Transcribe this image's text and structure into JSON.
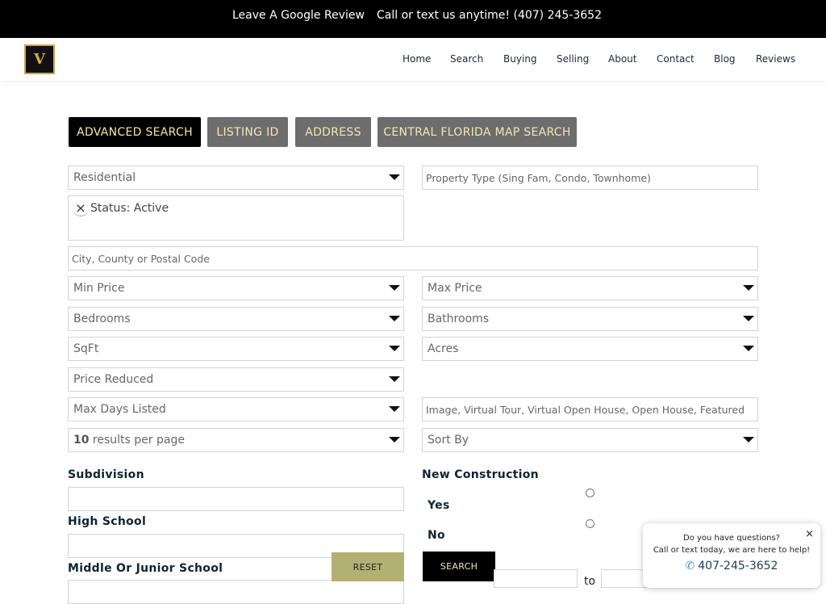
{
  "topbar": {
    "review": "Leave A Google Review",
    "call": "Call or text us anytime! (407) 245-3652"
  },
  "logo": {
    "letter": "V"
  },
  "nav": [
    "Home",
    "Search",
    "Buying",
    "Selling",
    "About",
    "Contact",
    "Blog",
    "Reviews"
  ],
  "tabs": [
    "ADVANCED SEARCH",
    "LISTING ID",
    "ADDRESS",
    "CENTRAL FLORIDA MAP SEARCH"
  ],
  "form": {
    "class_select": "Residential",
    "property_type_placeholder": "Property Type (Sing Fam, Condo, Townhome)",
    "status_chip": "Status: Active",
    "status_chip_remove": "×",
    "location_placeholder": "City, County or Postal Code",
    "min_price": "Min Price",
    "max_price": "Max Price",
    "bedrooms": "Bedrooms",
    "bathrooms": "Bathrooms",
    "sqft": "SqFt",
    "acres": "Acres",
    "price_reduced": "Price Reduced",
    "max_days": "Max Days Listed",
    "features_placeholder": "Image, Virtual Tour, Virtual Open House, Open House, Featured",
    "results_count": "10",
    "results_suffix": " results per page",
    "sort_by": "Sort By",
    "subdivision_label": "Subdivision",
    "high_school_label": "High School",
    "middle_school_label": "Middle Or Junior School",
    "new_construction_label": "New Construction",
    "yes": "Yes",
    "no": "No",
    "reset": "RESET",
    "search": "SEARCH",
    "to": "to"
  },
  "chat": {
    "line1": "Do you have questions?",
    "line2": "Call or text today, we are here to help!",
    "phone": "407-245-3652",
    "phone_icon": "phone-icon",
    "close": "×"
  },
  "colors": {
    "accent_gold": "#f1e7b5",
    "reset_bg": "#b3b074",
    "tab_inactive": "#6d6d6d"
  }
}
